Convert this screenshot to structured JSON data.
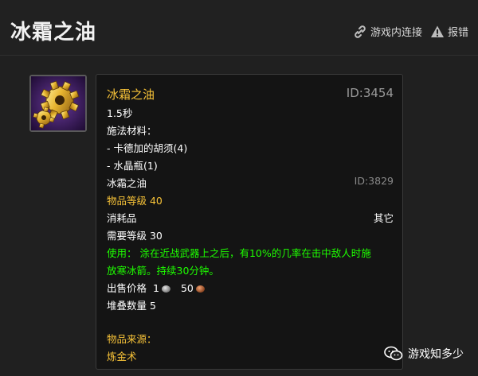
{
  "header": {
    "title": "冰霜之油",
    "connect_label": "游戏内连接",
    "report_label": "报错"
  },
  "tooltip": {
    "name": "冰霜之油",
    "id": "ID:3454",
    "cast_time": "1.5秒",
    "reagents_label": "施法材料：",
    "reagents": [
      "- 卡德加的胡须(4)",
      "- 水晶瓶(1)"
    ],
    "item": {
      "name": "冰霜之油",
      "id": "ID:3829",
      "item_level": "物品等级 40",
      "type": "消耗品",
      "subtype": "其它",
      "required_level": "需要等级 30",
      "use_line1": "使用： 涂在近战武器上之后，有10%的几率在击中敌人时施",
      "use_line2": "放寒冰箭。持续30分钟。",
      "sell_label": "出售价格",
      "sell_silver": "1",
      "sell_copper": "50",
      "stack": "堆叠数量 5",
      "source_label": "物品来源：",
      "source": "炼金术"
    }
  },
  "watermark": {
    "text": "游戏知多少"
  },
  "colors": {
    "item_name": "#f8c338",
    "use_text": "#1eff00",
    "id_text": "#9a9a9a",
    "background": "#202020"
  }
}
